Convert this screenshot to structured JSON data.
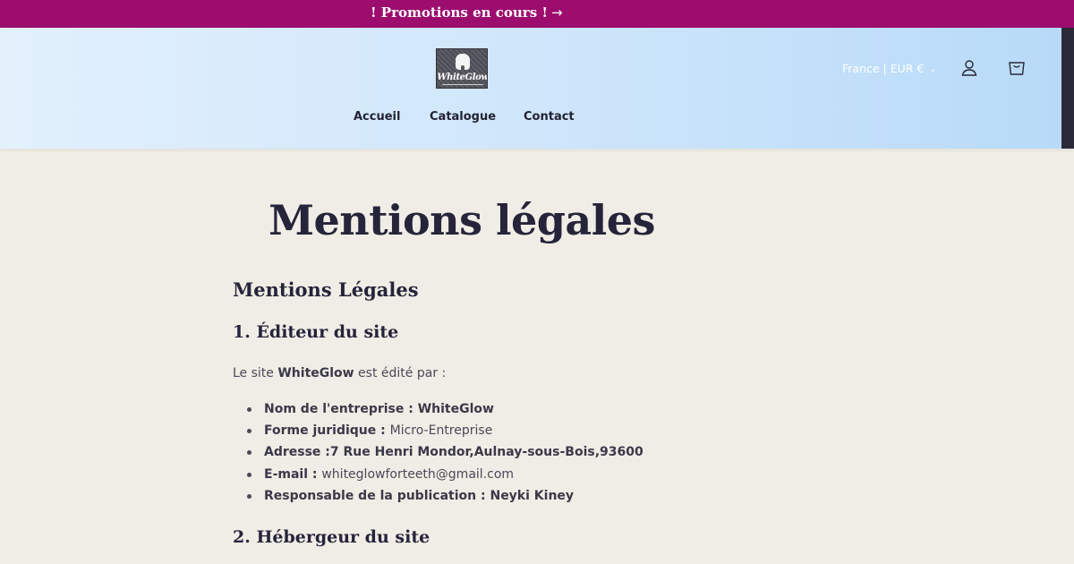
{
  "announcement": {
    "text": "! Promotions en cours !",
    "arrow": "→"
  },
  "header": {
    "logo_text": "WhiteGlow",
    "nav": [
      "Accueil",
      "Catalogue",
      "Contact"
    ],
    "locale": "France | EUR €",
    "locale_chevron": "⌄"
  },
  "main": {
    "page_title": "Mentions légales",
    "heading": "Mentions Légales",
    "section1_title": "1. Éditeur du site",
    "intro_prefix": "Le site ",
    "intro_brand": "WhiteGlow",
    "intro_suffix": " est édité par :",
    "details": [
      {
        "label": "Nom de l'entreprise : WhiteGlow",
        "value": ""
      },
      {
        "label": "Forme juridique : ",
        "value": "Micro-Entreprise"
      },
      {
        "label": "Adresse :7 Rue Henri Mondor,Aulnay-sous-Bois,93600",
        "value": ""
      },
      {
        "label": "E-mail : ",
        "value": "whiteglowforteeth@gmail.com"
      },
      {
        "label": "Responsable de la publication : Neyki Kiney",
        "value": ""
      }
    ],
    "section2_title": "2. Hébergeur du site"
  },
  "colors": {
    "announcement_bg": "#9c0d6e",
    "header_gradient_start": "#e2f0fc",
    "header_gradient_end": "#b7daf8",
    "page_bg": "#f0ede6",
    "heading_text": "#25243a"
  },
  "icons": [
    "arrow-right-icon",
    "chevron-down-icon",
    "account-icon",
    "cart-icon",
    "tooth-logo-icon"
  ]
}
